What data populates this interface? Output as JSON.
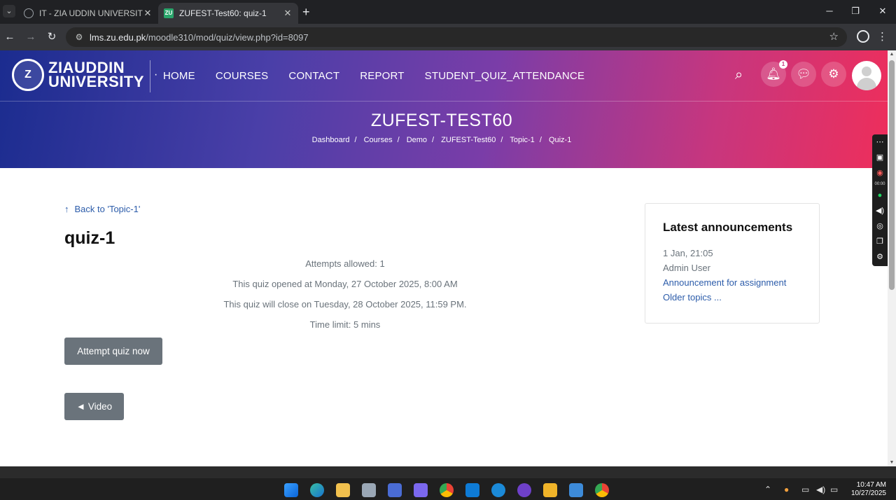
{
  "browser": {
    "tabs": [
      {
        "title": "IT - ZIA UDDIN UNIVERSITY",
        "active": false
      },
      {
        "title": "ZUFEST-Test60: quiz-1",
        "active": true,
        "favicon_text": "ZU"
      }
    ],
    "url_host": "lms.zu.edu.pk",
    "url_path": "/moodle310/mod/quiz/view.php?id=8097"
  },
  "site": {
    "logo_text_line1": "ZIAUDDIN",
    "logo_text_line2": "UNIVERSITY",
    "logo_seal_text": "Z",
    "nav": [
      "HOME",
      "COURSES",
      "CONTACT",
      "REPORT",
      "STUDENT_QUIZ_ATTENDANCE"
    ],
    "notification_count": "1"
  },
  "header": {
    "course_title": "ZUFEST-TEST60",
    "breadcrumb": [
      "Dashboard",
      "Courses",
      "Demo",
      "ZUFEST-Test60",
      "Topic-1",
      "Quiz-1"
    ]
  },
  "side_tools": {
    "timer": "00:00"
  },
  "main": {
    "back_link": "Back to 'Topic-1'",
    "quiz_title": "quiz-1",
    "info": [
      "Attempts allowed: 1",
      "This quiz opened at Monday, 27 October 2025, 8:00 AM",
      "This quiz will close on Tuesday, 28 October 2025, 11:59 PM.",
      "Time limit: 5 mins"
    ],
    "attempt_button": "Attempt quiz now",
    "video_button": "◄ Video"
  },
  "announcements": {
    "heading": "Latest announcements",
    "date": "1 Jan, 21:05",
    "author": "Admin User",
    "post_link": "Announcement for assignment",
    "older_link": "Older topics ..."
  },
  "taskbar": {
    "time": "10:47 AM",
    "date": "10/27/2025"
  },
  "colors": {
    "hero_gradient_start": "#1b2c8f",
    "hero_gradient_end": "#ee2e5b",
    "link": "#2c5caa",
    "button": "#6a737b"
  }
}
